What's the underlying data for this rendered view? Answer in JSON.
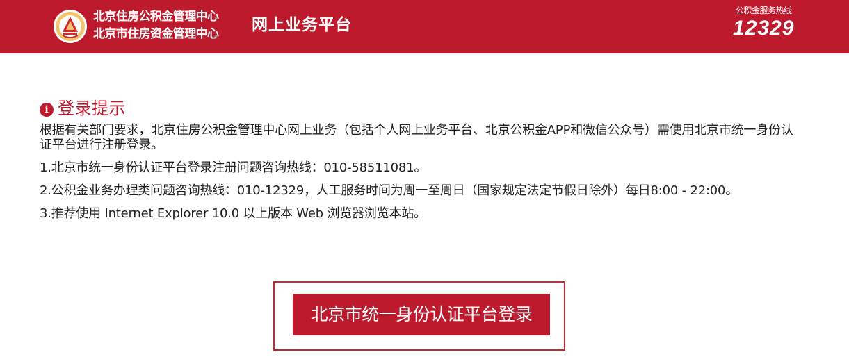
{
  "header": {
    "org_name_line1": "北京住房公积金管理中心",
    "org_name_line2": "北京市住房资金管理中心",
    "platform_title": "网上业务平台",
    "hotline_label": "公积金服务热线",
    "hotline_number": "12329",
    "background_color": "#be1a2e",
    "logo_icon": "housing-fund-emblem-icon"
  },
  "notice": {
    "icon": "info-icon",
    "icon_glyph": "i",
    "title": "登录提示",
    "intro": "根据有关部门要求，北京住房公积金管理中心网上业务（包括个人网上业务平台、北京公积金APP和微信公众号）需使用北京市统一身份认证平台进行注册登录。",
    "items": [
      "1.北京市统一身份认证平台登录注册问题咨询热线：010-58511081。",
      "2.公积金业务办理类问题咨询热线：010-12329，人工服务时间为周一至周日（国家规定法定节假日除外）每日8:00 - 22:00。",
      "3.推荐使用 Internet Explorer 10.0 以上版本 Web 浏览器浏览本站。"
    ],
    "title_color": "#be1a2e"
  },
  "login": {
    "button_label": "北京市统一身份认证平台登录",
    "button_color": "#be1a2e",
    "frame_color": "#d4252e"
  }
}
